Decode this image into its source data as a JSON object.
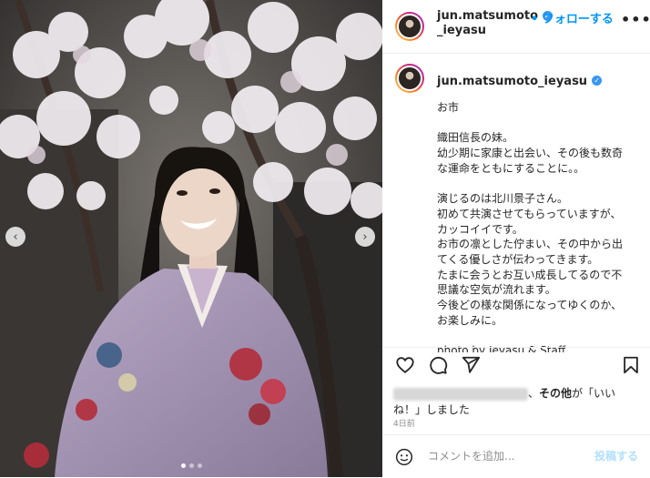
{
  "post": {
    "username": "jun.matsumoto_ieyasu",
    "username_line1": "jun.matsumoto",
    "username_line2": "_ieyasu",
    "follow_label": "• フォローする",
    "more_label": "•••",
    "caption_lines": [
      "お市",
      "",
      "織田信長の妹。",
      "幼少期に家康と出会い、その後も数奇",
      "な運命をともにすることに。。",
      "",
      "演じるのは北川景子さん。",
      "初めて共演させてもらっていますが、",
      "カッコイイです。",
      "お市の凛とした佇まい、その中から出",
      "てくる優しさが伝わってきます。",
      "たまに会うとお互い成長してるので不",
      "思議な空気が流れます。",
      "今後どの様な関係になってゆくのか、",
      "お楽しみに。",
      "",
      "photo by Ieyasu & Staff"
    ],
    "likes_suffix": "、",
    "likes_bold": "その他",
    "likes_tail": "が「いい",
    "likes_line2": "ね！」しました",
    "time": "4日前",
    "comment_placeholder": "コメントを追加...",
    "post_label": "投稿する"
  },
  "colors": {
    "accent": "#0095f6",
    "verified": "#3897f0",
    "post_disabled": "#b2dffc"
  },
  "icons": [
    "chevron-left-icon",
    "chevron-right-icon",
    "heart-icon",
    "comment-icon",
    "share-icon",
    "bookmark-icon",
    "emoji-icon",
    "verified-icon"
  ],
  "carousel": {
    "total": 3,
    "active": 1
  }
}
